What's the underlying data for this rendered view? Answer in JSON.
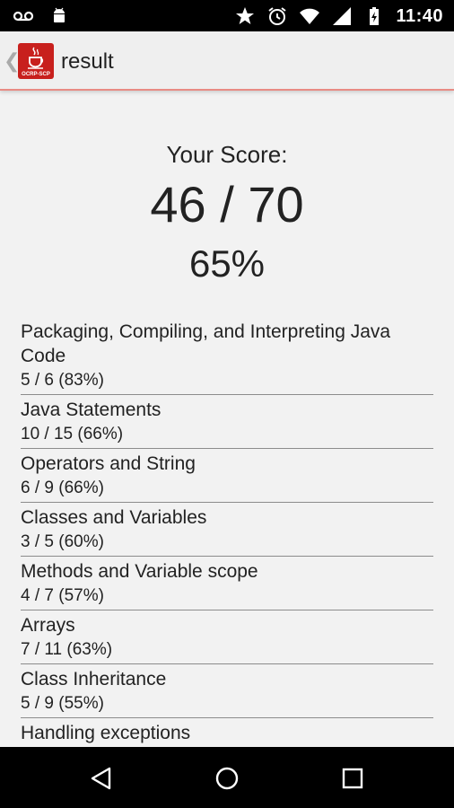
{
  "status_bar": {
    "time": "11:40",
    "left_icons": [
      "voicemail-icon",
      "android-icon"
    ],
    "right_icons": [
      "star-icon",
      "alarm-icon",
      "wifi-icon",
      "signal-icon",
      "battery-charging-icon"
    ]
  },
  "action_bar": {
    "title": "result",
    "logo_text": "OCRP-SCP"
  },
  "score": {
    "label": "Your Score:",
    "value": "46 / 70",
    "percent": "65%"
  },
  "categories": [
    {
      "title": "Packaging, Compiling, and Interpreting Java Code",
      "score": "5 / 6 (83%)"
    },
    {
      "title": "Java Statements",
      "score": "10 / 15 (66%)"
    },
    {
      "title": "Operators and String",
      "score": "6 / 9 (66%)"
    },
    {
      "title": "Classes and Variables",
      "score": "3 / 5 (60%)"
    },
    {
      "title": "Methods and Variable scope",
      "score": "4 / 7 (57%)"
    },
    {
      "title": "Arrays",
      "score": "7 / 11 (63%)"
    },
    {
      "title": "Class Inheritance",
      "score": "5 / 9 (55%)"
    },
    {
      "title": "Handling exceptions",
      "score": ""
    }
  ],
  "colors": {
    "accent_line": "#e88b84",
    "logo_red": "#c8201d",
    "background": "#f2f2f2"
  }
}
